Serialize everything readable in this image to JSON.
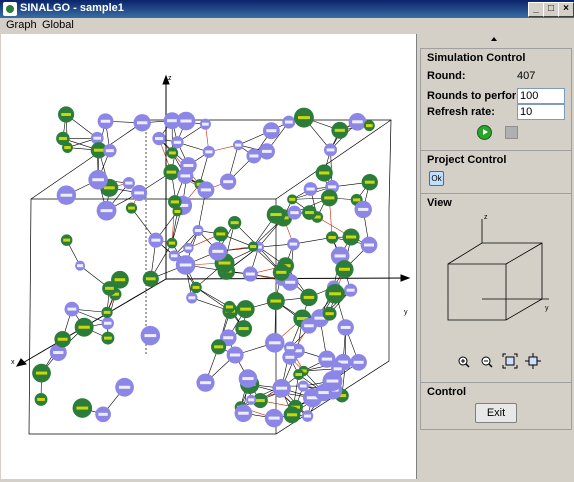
{
  "window": {
    "title": "SINALGO - sample1",
    "controls": [
      "_",
      "□",
      "×"
    ]
  },
  "menu": {
    "items": [
      "Graph",
      "Global"
    ]
  },
  "axis_labels": {
    "x": "x",
    "y": "y",
    "z": "z"
  },
  "simulation_control": {
    "title": "Simulation Control",
    "round_label": "Round:",
    "round_value": "407",
    "rounds_label": "Rounds to perform:",
    "rounds_value": "100",
    "refresh_label": "Refresh rate:",
    "refresh_value": "10"
  },
  "project_control": {
    "title": "Project Control",
    "ok_label": "Ok"
  },
  "view": {
    "title": "View",
    "axis_labels": {
      "x": "x",
      "y": "y",
      "z": "z"
    }
  },
  "control": {
    "title": "Control",
    "exit_label": "Exit"
  },
  "colors": {
    "node_green": "#2d7d3a",
    "node_purple": "#8c86e6",
    "label_yellow": "#e8e800",
    "edge_red": "#cc2200"
  }
}
